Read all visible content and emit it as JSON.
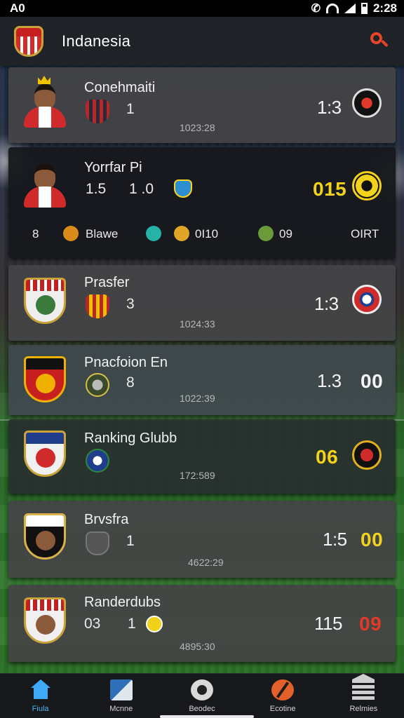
{
  "status_bar": {
    "left": "A0",
    "time": "2:28"
  },
  "app": {
    "title": "Indanesia"
  },
  "cards": [
    {
      "name": "Conehmaiti",
      "stat1": "1",
      "time": "1023:28",
      "score": "1:3",
      "score2": ""
    },
    {
      "name": "Yorrfar Pi",
      "stat1": "1.5",
      "stat2": "1 .0",
      "time": "",
      "score": "",
      "score2": "015",
      "events": [
        "8",
        "Blawe",
        "0I10",
        "09",
        "OIRT"
      ]
    },
    {
      "name": "Prasfer",
      "stat1": "3",
      "time": "1024:33",
      "score": "1:3",
      "score2": ""
    },
    {
      "name": "Pnacfoion En",
      "stat1": "8",
      "time": "1022:39",
      "score": "1.3",
      "score2": "00"
    },
    {
      "name": "Ranking Glubb",
      "stat1": "",
      "time": "172:589",
      "score": "",
      "score2": "06"
    },
    {
      "name": "Brvsfra",
      "stat1": "1",
      "time": "4622:29",
      "score": "1:5",
      "score2": "00"
    },
    {
      "name": "Randerdubs",
      "stat1": "03",
      "stat2": "1",
      "time": "4895:30",
      "score": "115",
      "score2": "09"
    }
  ],
  "colors": {
    "yellow": "#f2d21a",
    "white": "#f4f4f4",
    "red": "#e23a28",
    "accent": "#3fa9f5"
  },
  "nav": [
    {
      "label": "Fiula",
      "icon": "home-icon"
    },
    {
      "label": "Mcnne",
      "icon": "match-icon"
    },
    {
      "label": "Beodec",
      "icon": "score-icon"
    },
    {
      "label": "Ecotine",
      "icon": "stats-icon"
    },
    {
      "label": "Relmies",
      "icon": "ranking-icon"
    }
  ]
}
